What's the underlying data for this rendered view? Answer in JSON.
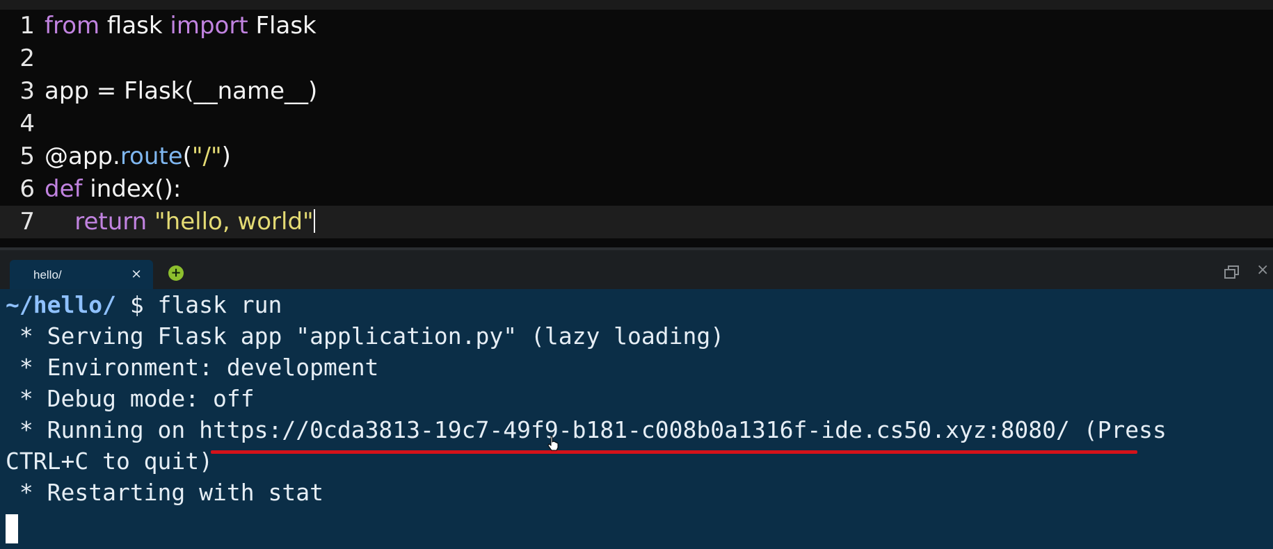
{
  "editor": {
    "lines": [
      {
        "number": "1",
        "tokens": [
          {
            "t": "from",
            "c": "kw"
          },
          {
            "t": " flask ",
            "c": "pl"
          },
          {
            "t": "import",
            "c": "kw"
          },
          {
            "t": " Flask",
            "c": "pl"
          }
        ]
      },
      {
        "number": "2",
        "tokens": []
      },
      {
        "number": "3",
        "tokens": [
          {
            "t": "app = Flask(__name__)",
            "c": "pl"
          }
        ]
      },
      {
        "number": "4",
        "tokens": []
      },
      {
        "number": "5",
        "tokens": [
          {
            "t": "@app.",
            "c": "pl"
          },
          {
            "t": "route",
            "c": "fn"
          },
          {
            "t": "(",
            "c": "pl"
          },
          {
            "t": "\"/\"",
            "c": "str"
          },
          {
            "t": ")",
            "c": "pl"
          }
        ]
      },
      {
        "number": "6",
        "tokens": [
          {
            "t": "def",
            "c": "kw"
          },
          {
            "t": " index():",
            "c": "pl"
          }
        ]
      },
      {
        "number": "7",
        "tokens": [
          {
            "t": "    ",
            "c": "pl"
          },
          {
            "t": "return",
            "c": "kw"
          },
          {
            "t": " ",
            "c": "pl"
          },
          {
            "t": "\"hello, world\"",
            "c": "str"
          }
        ]
      }
    ],
    "current_line": "7"
  },
  "terminal": {
    "tab_label": "hello/",
    "close_glyph": "×",
    "add_glyph": "+",
    "prompt_path": "~/hello/",
    "prompt_command": " $ flask run",
    "line_serving": " * Serving Flask app \"application.py\" (lazy loading)",
    "line_env": " * Environment: development",
    "line_debug": " * Debug mode: off",
    "running_prefix": " * Running on ",
    "running_url": "https://0cda3813-19c7-49f9-b181-c008b0a1316f-ide.cs50.xyz:8080/",
    "running_suffix": " (Press",
    "line_quit": "CTRL+C to quit)",
    "line_restart": " * Restarting with stat"
  },
  "colors": {
    "editor_bg": "#0a0a0a",
    "keyword": "#c183e0",
    "function": "#7fb6ef",
    "string": "#e4db74",
    "terminal_bg": "#0b2e47",
    "annotation_underline": "#d4121a",
    "add_button": "#8dbf2e"
  },
  "icons": [
    "close-icon",
    "add-tab-icon",
    "restore-window-icon",
    "mouse-pointer-icon"
  ]
}
